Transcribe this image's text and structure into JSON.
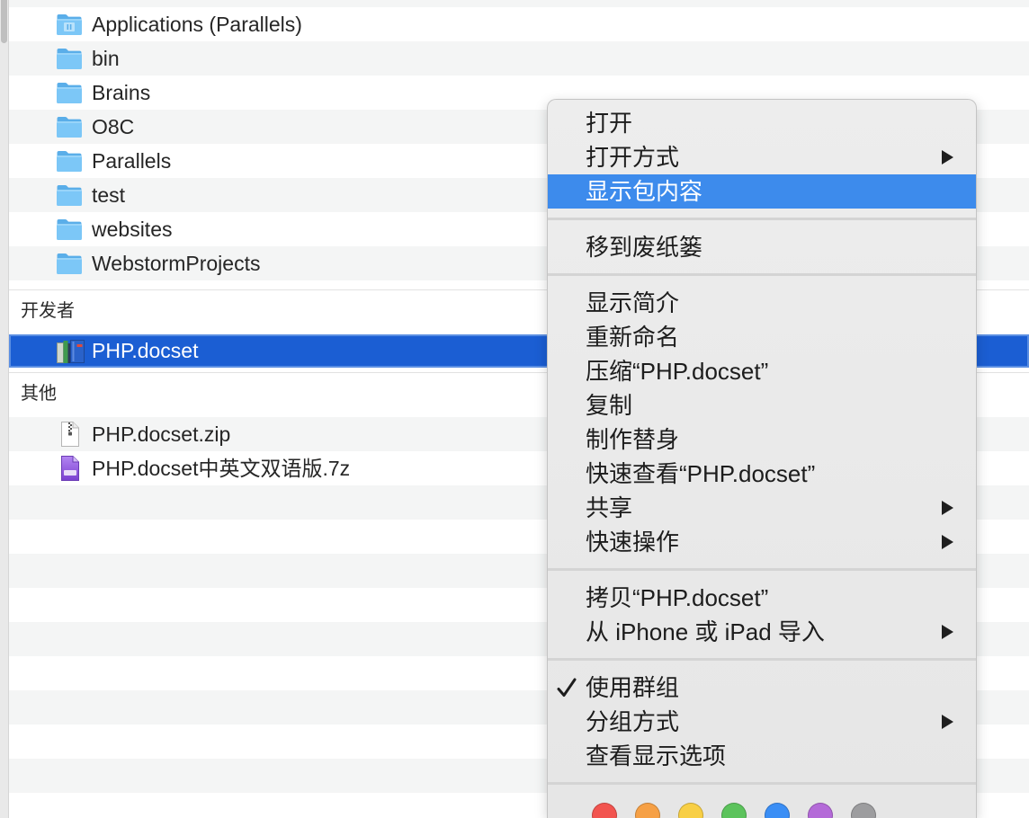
{
  "file_list": {
    "folders": [
      {
        "name": "Applications (Parallels)",
        "icon": "parallels-applications-folder-icon"
      },
      {
        "name": "bin",
        "icon": "folder-icon"
      },
      {
        "name": "Brains",
        "icon": "folder-icon"
      },
      {
        "name": "O8C",
        "icon": "folder-icon"
      },
      {
        "name": "Parallels",
        "icon": "folder-icon"
      },
      {
        "name": "test",
        "icon": "folder-icon"
      },
      {
        "name": "websites",
        "icon": "folder-icon"
      },
      {
        "name": "WebstormProjects",
        "icon": "folder-icon"
      }
    ],
    "groups": [
      {
        "header": "开发者",
        "items": [
          {
            "name": "PHP.docset",
            "icon": "docset-package-icon",
            "selected": true
          }
        ]
      },
      {
        "header": "其他",
        "items": [
          {
            "name": "PHP.docset.zip",
            "icon": "zip-archive-icon"
          },
          {
            "name": "PHP.docset中英文双语版.7z",
            "icon": "7z-archive-icon"
          }
        ]
      }
    ]
  },
  "context_menu": {
    "sections": [
      [
        {
          "label": "打开"
        },
        {
          "label": "打开方式",
          "submenu": true
        },
        {
          "label": "显示包内容",
          "highlighted": true
        }
      ],
      [
        {
          "label": "移到废纸篓"
        }
      ],
      [
        {
          "label": "显示简介"
        },
        {
          "label": "重新命名"
        },
        {
          "label": "压缩“PHP.docset”"
        },
        {
          "label": "复制"
        },
        {
          "label": "制作替身"
        },
        {
          "label": "快速查看“PHP.docset”"
        },
        {
          "label": "共享",
          "submenu": true
        },
        {
          "label": "快速操作",
          "submenu": true
        }
      ],
      [
        {
          "label": "拷贝“PHP.docset”"
        },
        {
          "label": "从 iPhone 或 iPad 导入",
          "submenu": true
        }
      ],
      [
        {
          "label": "使用群组",
          "checked": true
        },
        {
          "label": "分组方式",
          "submenu": true
        },
        {
          "label": "查看显示选项"
        }
      ]
    ],
    "tag_colors": [
      "#f2544f",
      "#f6a045",
      "#f8cf45",
      "#5cc35c",
      "#3a8ef5",
      "#b46ad8",
      "#9d9d9f"
    ]
  },
  "colors": {
    "selection": "#1b5ed3",
    "menu_highlight": "#3d8bec"
  }
}
